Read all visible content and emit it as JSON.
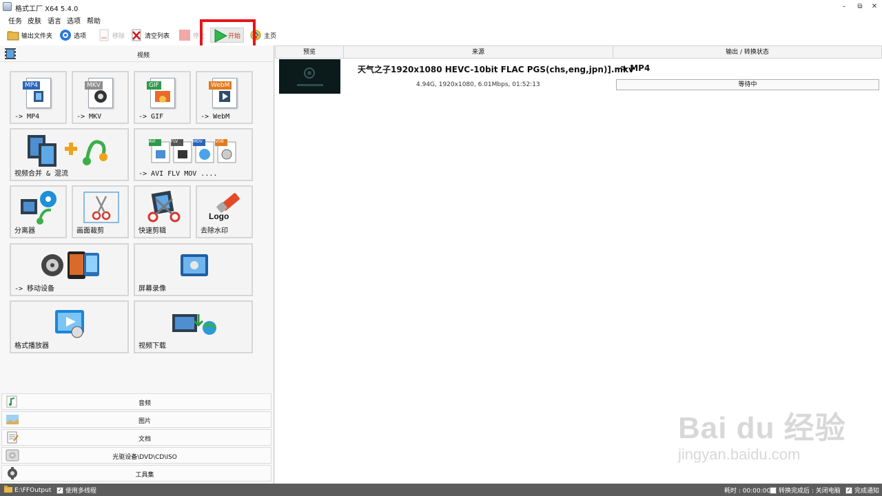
{
  "window": {
    "title": "格式工厂 X64 5.4.0"
  },
  "menu": [
    "任务",
    "皮肤",
    "语言",
    "选项",
    "帮助"
  ],
  "toolbar": {
    "output_folder": "输出文件夹",
    "options": "选项",
    "remove": "移除",
    "clear_list": "清空列表",
    "stop": "停止",
    "start": "开始",
    "home": "主页"
  },
  "left": {
    "video_category": "视频",
    "tiles": {
      "mp4": {
        "tag": "MP4",
        "label": "-> MP4"
      },
      "mkv": {
        "tag": "MKV",
        "label": "-> MKV"
      },
      "gif": {
        "tag": "GIF",
        "label": "-> GIF"
      },
      "webm": {
        "tag": "WebM",
        "label": "-> WebM"
      },
      "merge": {
        "label": "视频合并 & 混流"
      },
      "avi": {
        "tags": [
          "AVI",
          "FLV",
          "MOV",
          "VOB"
        ],
        "label": "-> AVI FLV MOV ...."
      },
      "splitter": {
        "label": "分离器"
      },
      "crop": {
        "label": "画面裁剪"
      },
      "quickcut": {
        "label": "快速剪辑"
      },
      "logo": {
        "label": "去除水印",
        "logo_text": "Logo"
      },
      "mobile": {
        "label": "-> 移动设备"
      },
      "record": {
        "label": "屏幕录像"
      },
      "player": {
        "label": "格式播放器"
      },
      "download": {
        "label": "视频下载"
      }
    },
    "bottom_categories": [
      "音频",
      "图片",
      "文档",
      "光驱设备\\DVD\\CD\\ISO",
      "工具集"
    ]
  },
  "task_list": {
    "columns": [
      "预览",
      "来源",
      "输出 / 转换状态"
    ],
    "rows": [
      {
        "source_name": "天气之子1920x1080 HEVC-10bit FLAC PGS(chs,eng,jpn)].mkv",
        "source_meta": "4.94G, 1920x1080, 6.01Mbps, 01:52:13",
        "output": "-> MP4",
        "status": "等待中"
      }
    ]
  },
  "statusbar": {
    "output_path": "E:\\FFOutput",
    "multithread": "使用多线程",
    "elapsed": "耗时 : 00:00:00",
    "after_convert": "转换完成后 : 关闭电脑",
    "notify": "完成通知"
  },
  "watermark": {
    "main": "Bai du 经验",
    "sub": "jingyan.baidu.com"
  },
  "colors": {
    "highlight": "#e8131c",
    "statusbar": "#5c5c5c",
    "start_green": "#2db84a"
  }
}
